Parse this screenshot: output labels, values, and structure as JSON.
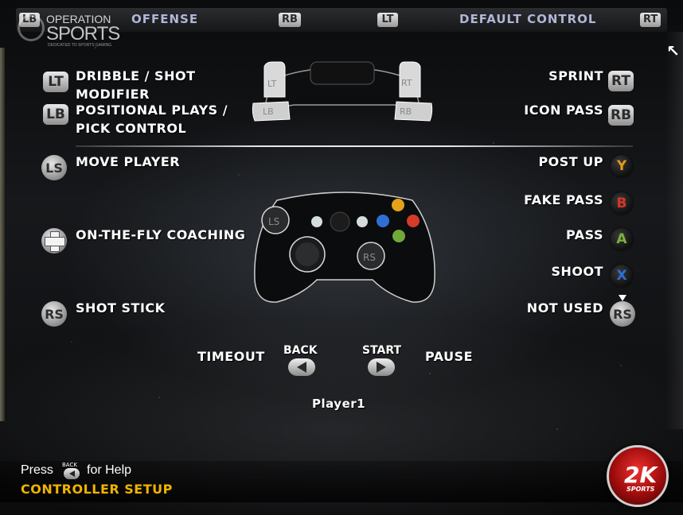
{
  "logo": {
    "line1": "OPERATION",
    "line2": "SPORTS",
    "tagline": "DEDICATED TO SPORTS GAMING"
  },
  "topbar": {
    "left_bumper": "LB",
    "title": "OFFENSE",
    "rb_tag": "RB",
    "lt_tag": "LT",
    "scheme": "DEFAULT CONTROL",
    "right_trigger": "RT"
  },
  "controls_left": [
    {
      "button": "LT",
      "label_line1": "DRIBBLE / SHOT",
      "label_line2": "MODIFIER"
    },
    {
      "button": "LB",
      "label_line1": "POSITIONAL PLAYS /",
      "label_line2": "PICK CONTROL"
    },
    {
      "button": "LS",
      "label_line1": "MOVE PLAYER"
    },
    {
      "button": "D-Pad",
      "label_line1": "ON-THE-FLY COACHING"
    },
    {
      "button": "RS",
      "label_line1": "SHOT STICK"
    }
  ],
  "controls_right": [
    {
      "button": "RT",
      "label": "SPRINT"
    },
    {
      "button": "RB",
      "label": "ICON PASS"
    },
    {
      "button": "Y",
      "label": "POST UP",
      "color": "#e39a1c"
    },
    {
      "button": "B",
      "label": "FAKE PASS",
      "color": "#d6352b"
    },
    {
      "button": "A",
      "label": "PASS",
      "color": "#7db23a"
    },
    {
      "button": "X",
      "label": "SHOOT",
      "color": "#2f6fd6"
    },
    {
      "button": "RS",
      "label": "NOT USED"
    }
  ],
  "controller_diagram": {
    "lt": "LT",
    "rt": "RT",
    "lb": "LB",
    "rb": "RB",
    "ls": "LS",
    "rs": "RS"
  },
  "center": {
    "timeout_label": "TIMEOUT",
    "back_label": "BACK",
    "start_label": "START",
    "pause_label": "PAUSE",
    "player": "Player1"
  },
  "footer": {
    "press": "Press",
    "back_mini": "BACK",
    "for_help": "for Help",
    "section": "CONTROLLER SETUP",
    "brand_big": "2K",
    "brand_small": "SPORTS"
  }
}
